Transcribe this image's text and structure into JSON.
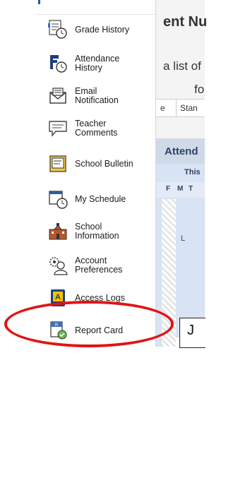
{
  "sidebar": {
    "items": [
      {
        "label": "Grade History",
        "icon": "grade-history-icon"
      },
      {
        "label": "Attendance\nHistory",
        "icon": "attendance-history-icon"
      },
      {
        "label": "Email\nNotification",
        "icon": "email-icon"
      },
      {
        "label": "Teacher\nComments",
        "icon": "comments-icon"
      },
      {
        "label": "School Bulletin",
        "icon": "bulletin-icon"
      },
      {
        "label": "My Schedule",
        "icon": "schedule-icon"
      },
      {
        "label": "School\nInformation",
        "icon": "school-icon"
      },
      {
        "label": "Account\nPreferences",
        "icon": "account-icon"
      },
      {
        "label": "Access Logs",
        "icon": "access-logs-icon"
      },
      {
        "label": "Report Card",
        "icon": "report-card-icon"
      }
    ]
  },
  "content": {
    "title_partial": "ent Nu",
    "sub_line1": "a list of",
    "sub_line2": "fo",
    "tabs": [
      "e",
      "Stan"
    ],
    "attendance_title": "Attend",
    "this_label": "This",
    "days": [
      "F",
      "M",
      "T"
    ],
    "cell_value": "L",
    "j_letter": "J"
  },
  "annotation": {
    "color": "#e01414",
    "target": "Report Card"
  }
}
